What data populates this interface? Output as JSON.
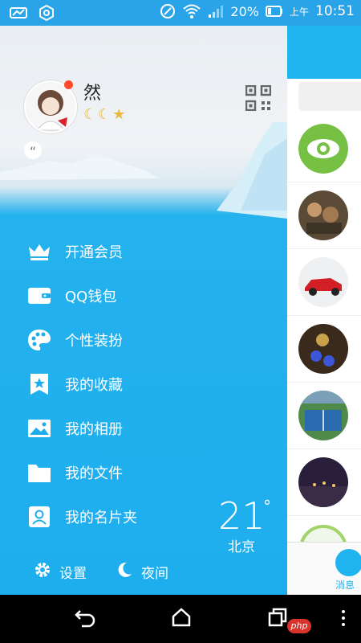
{
  "status_bar": {
    "battery": "20%",
    "ampm": "上午",
    "time": "10:51"
  },
  "profile": {
    "nickname": "然",
    "level_icons": [
      "moon-icon",
      "moon-icon",
      "star-icon"
    ],
    "signature_quote": "“"
  },
  "menu": {
    "items": [
      {
        "label": "开通会员",
        "icon": "crown-icon"
      },
      {
        "label": "QQ钱包",
        "icon": "wallet-icon"
      },
      {
        "label": "个性装扮",
        "icon": "palette-icon"
      },
      {
        "label": "我的收藏",
        "icon": "bookmark-star-icon"
      },
      {
        "label": "我的相册",
        "icon": "photo-icon"
      },
      {
        "label": "我的文件",
        "icon": "folder-icon"
      },
      {
        "label": "我的名片夹",
        "icon": "contact-card-icon"
      }
    ]
  },
  "bottom": {
    "settings_label": "设置",
    "night_label": "夜间"
  },
  "weather": {
    "temperature": "21",
    "degree_symbol": "°",
    "city": "北京"
  },
  "main_panel": {
    "message_tab_label": "消息"
  },
  "navbar": {
    "badge_text": "php"
  },
  "colors": {
    "accent": "#1eaeee",
    "badge_red": "#ff4b2b"
  }
}
